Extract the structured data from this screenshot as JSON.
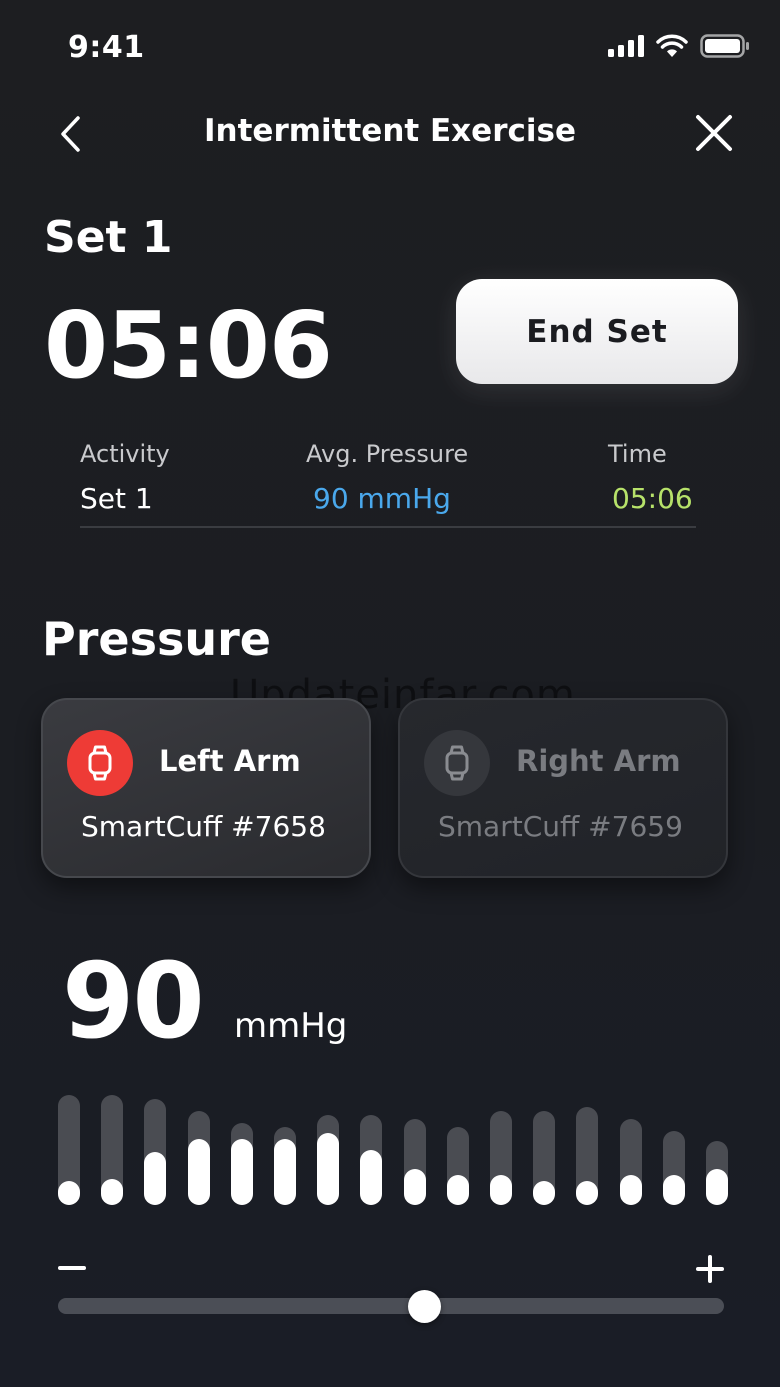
{
  "status_bar": {
    "time": "9:41"
  },
  "nav": {
    "title": "Intermittent Exercise"
  },
  "session": {
    "set_title": "Set 1",
    "timer": "05:06",
    "end_button": "End Set"
  },
  "stats": [
    {
      "label": "Activity",
      "value": "Set 1"
    },
    {
      "label": "Avg. Pressure",
      "value": "90 mmHg"
    },
    {
      "label": "Time",
      "value": "05:06"
    }
  ],
  "pressure": {
    "heading": "Pressure",
    "watermark": "Updateinfar.com",
    "cuffs": [
      {
        "name": "Left Arm",
        "device": "SmartCuff #7658",
        "selected": true
      },
      {
        "name": "Right Arm",
        "device": "SmartCuff #7659",
        "selected": false
      }
    ],
    "value": "90",
    "unit": "mmHg",
    "slider_level": 0.55,
    "history_levels": [
      0.12,
      0.22,
      0.44,
      0.55,
      0.55,
      0.55,
      0.6,
      0.46,
      0.3,
      0.25,
      0.25,
      0.15,
      0.15,
      0.25,
      0.25,
      0.3
    ]
  },
  "colors": {
    "avg_pressure": "#4aa8ec",
    "time": "#b7e26a",
    "active_cuff": "#ee3b36"
  },
  "icons": [
    "chevron-left-icon",
    "close-icon",
    "signal-icon",
    "wifi-icon",
    "battery-icon",
    "watch-icon"
  ]
}
